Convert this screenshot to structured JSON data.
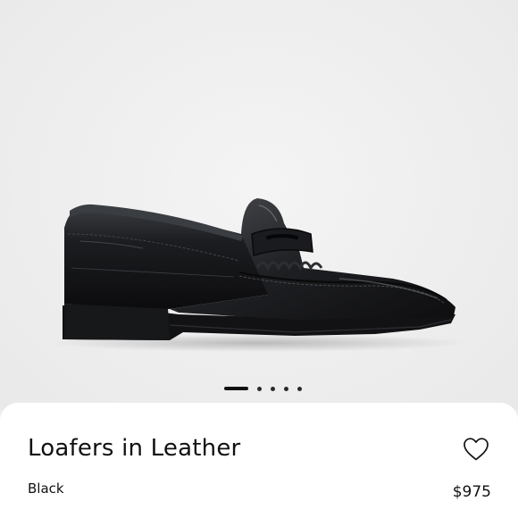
{
  "product": {
    "title": "Loafers in Leather",
    "color": "Black",
    "price": "$975",
    "favorite_icon": "heart-outline-icon"
  },
  "gallery": {
    "image_count": 5,
    "active_index": 0
  },
  "colors": {
    "background": "#efefef",
    "card": "#ffffff",
    "text": "#111111"
  }
}
